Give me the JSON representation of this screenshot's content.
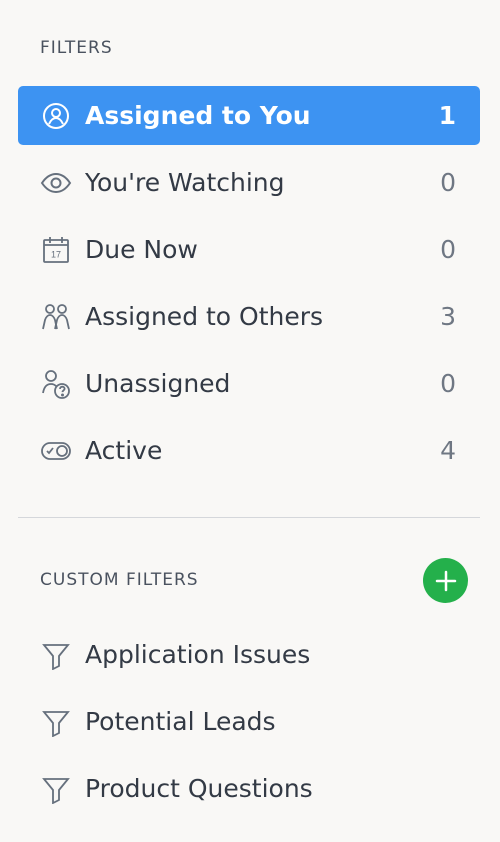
{
  "filters_header": "FILTERS",
  "filters": [
    {
      "label": "Assigned to You",
      "count": "1",
      "icon": "user-icon"
    },
    {
      "label": "You're Watching",
      "count": "0",
      "icon": "eye-icon"
    },
    {
      "label": "Due Now",
      "count": "0",
      "icon": "calendar-icon",
      "calendar_day": "17"
    },
    {
      "label": "Assigned to Others",
      "count": "3",
      "icon": "users-icon"
    },
    {
      "label": "Unassigned",
      "count": "0",
      "icon": "unassigned-user-icon"
    },
    {
      "label": "Active",
      "count": "4",
      "icon": "toggle-icon"
    }
  ],
  "custom_filters_header": "CUSTOM FILTERS",
  "custom_filters": [
    {
      "label": "Application Issues",
      "icon": "funnel-icon"
    },
    {
      "label": "Potential Leads",
      "icon": "funnel-icon"
    },
    {
      "label": "Product Questions",
      "icon": "funnel-icon"
    }
  ],
  "colors": {
    "selected_background": "#3d93f2",
    "add_button": "#24b04b",
    "text": "#333a45"
  }
}
